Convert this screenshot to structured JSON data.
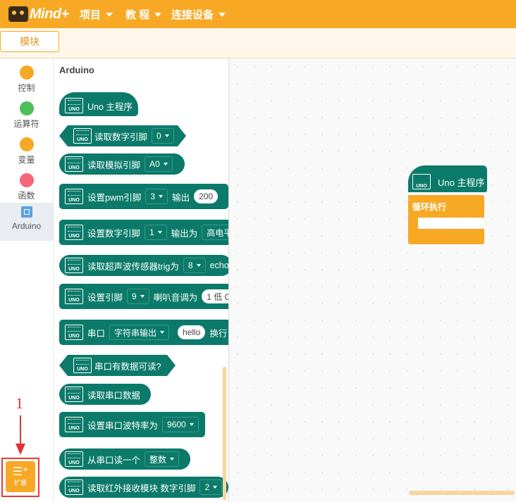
{
  "app": {
    "logo_text": "Mind+"
  },
  "menu": [
    {
      "label": "项目"
    },
    {
      "label": "教 程"
    },
    {
      "label": "连接设备"
    }
  ],
  "tab": {
    "label": "模块"
  },
  "categories": [
    {
      "label": "控制",
      "color": "#f7a824"
    },
    {
      "label": "运算符",
      "color": "#4cbf56"
    },
    {
      "label": "变量",
      "color": "#f7a824"
    },
    {
      "label": "函数",
      "color": "#f5677a"
    },
    {
      "label": "Arduino",
      "color": "#5aa0e6"
    }
  ],
  "palette": {
    "title": "Arduino",
    "uno_badge": "UNO",
    "blocks": [
      {
        "text": "Uno 主程序"
      },
      {
        "text": "读取数字引脚",
        "dropdown": "0"
      },
      {
        "text": "读取模拟引脚",
        "dropdown": "A0"
      },
      {
        "text": "设置pwm引脚",
        "dropdown": "3",
        "text2": "输出",
        "value": "200"
      },
      {
        "text": "设置数字引脚",
        "dropdown": "1",
        "text2": "输出为",
        "dropdown2": "高电平"
      },
      {
        "text": "读取超声波传感器trig为",
        "dropdown": "8",
        "text2": "echo"
      },
      {
        "text": "设置引脚",
        "dropdown": "9",
        "text2": "喇叭音调为",
        "value": "1 低 C"
      },
      {
        "text": "串口",
        "dropdown": "字符串输出",
        "value": "hello",
        "text2": "换行"
      },
      {
        "text": "串口有数据可读?"
      },
      {
        "text": "读取串口数据"
      },
      {
        "text": "设置串口波特率为",
        "dropdown": "9600"
      },
      {
        "text": "从串口读一个",
        "dropdown": "整数"
      },
      {
        "text": "读取红外接收模块 数字引脚",
        "dropdown": "2"
      }
    ]
  },
  "workspace": {
    "main_block": "Uno 主程序",
    "loop_block": "循环执行"
  },
  "extension": {
    "label": "扩展",
    "icon": "extension-icon"
  },
  "annotation": {
    "number": "1"
  }
}
